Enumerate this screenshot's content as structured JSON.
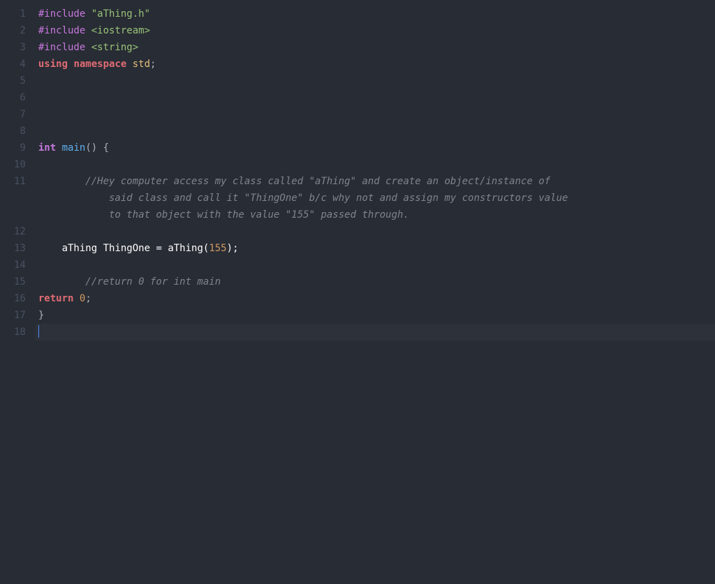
{
  "line_numbers": [
    "1",
    "2",
    "3",
    "4",
    "5",
    "6",
    "7",
    "8",
    "9",
    "10",
    "11",
    "",
    "",
    "12",
    "13",
    "14",
    "15",
    "16",
    "17",
    "18"
  ],
  "code": {
    "l1": {
      "include": "#include ",
      "header": "\"aThing.h\""
    },
    "l2": {
      "include": "#include ",
      "header": "<iostream>"
    },
    "l3": {
      "include": "#include ",
      "header": "<string>"
    },
    "l4": {
      "using": "using",
      "namespace": "namespace",
      "std": "std",
      "semi": ";"
    },
    "l9": {
      "int": "int",
      "main": "main",
      "parens": "()",
      "brace": " {"
    },
    "l11": {
      "comment_a": "        //Hey computer access my class called \"aThing\" and create an object/instance of ",
      "comment_b": "            said class and call it \"ThingOne\" b/c why not and assign my constructors value ",
      "comment_c": "            to that object with the value \"155\" passed through."
    },
    "l13": {
      "indent": "    ",
      "type": "aThing ",
      "var": "ThingOne ",
      "eq": "= ",
      "ctor": "aThing",
      "lp": "(",
      "num": "155",
      "rp": ")",
      "semi": ";"
    },
    "l15": {
      "comment": "        //return 0 for int main"
    },
    "l16": {
      "return": "return",
      "zero": "0",
      "semi": ";"
    },
    "l17": {
      "brace": "}"
    }
  }
}
